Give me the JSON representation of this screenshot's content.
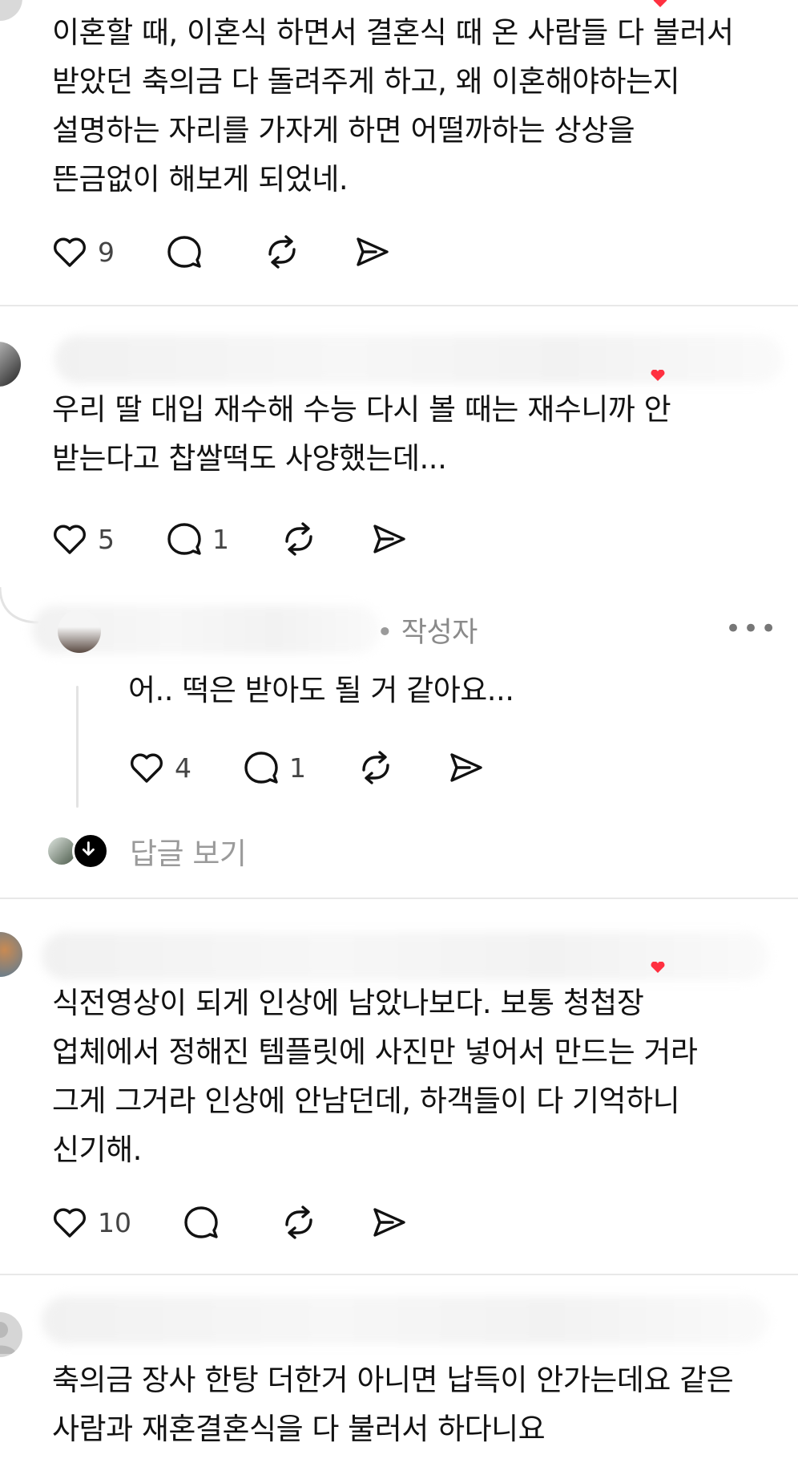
{
  "comments": [
    {
      "text": "이혼할 때, 이혼식 하면서 결혼식 때 온 사람들 다 불러서\n받았던 축의금 다 돌려주게 하고, 왜 이혼해야하는지\n설명하는 자리를 가자게 하면 어떨까하는 상상을\n뜬금없이 해보게 되었네.",
      "likes": "9",
      "replies": ""
    },
    {
      "text": "우리 딸 대입 재수해 수능 다시 볼 때는 재수니까 안\n받는다고 찹쌀떡도 사양했는데...",
      "likes": "5",
      "replies": "1"
    },
    {
      "text": "식전영상이 되게 인상에 남았나보다. 보통 청첩장\n업체에서 정해진 템플릿에 사진만 넣어서 만드는 거라\n그게 그거라 인상에 안남던데, 하객들이 다 기억하니\n신기해.",
      "likes": "10",
      "replies": ""
    },
    {
      "text": "축의금 장사 한탕 더한거 아니면 납득이 안가는데요 같은\n사람과 재혼결혼식을 다 불러서 하다니요",
      "likes": "",
      "replies": ""
    }
  ],
  "reply": {
    "author_tag": "작성자",
    "more_label": "•••",
    "text": "어.. 떡은 받아도 될 거 같아요...",
    "likes": "4",
    "replies": "1"
  },
  "view_replies_label": "답글 보기",
  "icons": {
    "like": "heart-icon",
    "comment": "speech-bubble-icon",
    "repost": "repost-icon",
    "share": "send-icon"
  },
  "colors": {
    "badge": "#ff3040",
    "muted": "#8a8a8a"
  }
}
